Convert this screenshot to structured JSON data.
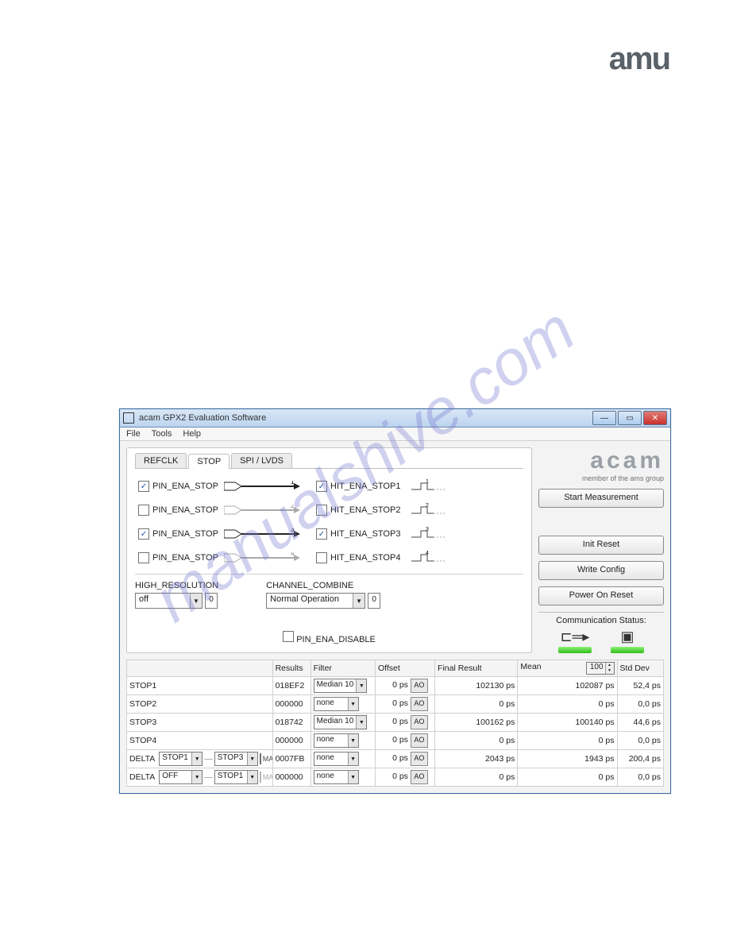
{
  "logo_corner": "amu",
  "watermark": "manualshive.com",
  "window": {
    "title": "acam GPX2 Evaluation Software",
    "menus": [
      "File",
      "Tools",
      "Help"
    ],
    "tabs": [
      "REFCLK",
      "STOP",
      "SPI / LVDS"
    ],
    "active_tab": 1
  },
  "pins": [
    {
      "label": "PIN_ENA_STOP",
      "checked": true,
      "arrow_on": true,
      "num": "1"
    },
    {
      "label": "PIN_ENA_STOP",
      "checked": false,
      "arrow_on": false,
      "num": "2"
    },
    {
      "label": "PIN_ENA_STOP",
      "checked": true,
      "arrow_on": true,
      "num": "3"
    },
    {
      "label": "PIN_ENA_STOP",
      "checked": false,
      "arrow_on": false,
      "num": "4"
    }
  ],
  "hits": [
    {
      "label": "HIT_ENA_STOP1",
      "checked": true,
      "num": "1"
    },
    {
      "label": "HIT_ENA_STOP2",
      "checked": false,
      "num": "2"
    },
    {
      "label": "HIT_ENA_STOP3",
      "checked": true,
      "num": "3"
    },
    {
      "label": "HIT_ENA_STOP4",
      "checked": false,
      "num": "4"
    }
  ],
  "cfg": {
    "high_res_label": "HIGH_RESOLUTION",
    "high_res_value": "off",
    "high_res_num": "0",
    "chan_combine_label": "CHANNEL_COMBINE",
    "chan_combine_value": "Normal Operation",
    "chan_combine_num": "0",
    "pin_ena_disable": "PIN_ENA_DISABLE"
  },
  "sidebar": {
    "acam_big": "acam",
    "acam_sub": "member of the ams group",
    "start": "Start Measurement",
    "init": "Init Reset",
    "write": "Write Config",
    "por": "Power On Reset",
    "comm_label": "Communication Status:"
  },
  "table": {
    "headers": [
      "",
      "Results",
      "Filter",
      "Offset",
      "Final Result",
      "Mean",
      "Std Dev"
    ],
    "mean_spin": "100",
    "rows": [
      {
        "label": "STOP1",
        "results": "018EF2",
        "filter": "Median 10",
        "offset": "0 ps",
        "final": "102130 ps",
        "mean": "102087 ps",
        "stddev": "52,4 ps"
      },
      {
        "label": "STOP2",
        "results": "000000",
        "filter": "none",
        "offset": "0 ps",
        "final": "0 ps",
        "mean": "0 ps",
        "stddev": "0,0 ps"
      },
      {
        "label": "STOP3",
        "results": "018742",
        "filter": "Median 10",
        "offset": "0 ps",
        "final": "100162 ps",
        "mean": "100140 ps",
        "stddev": "44,6 ps"
      },
      {
        "label": "STOP4",
        "results": "000000",
        "filter": "none",
        "offset": "0 ps",
        "final": "0 ps",
        "mean": "0 ps",
        "stddev": "0,0 ps"
      }
    ],
    "deltas": [
      {
        "a": "STOP1",
        "b": "STOP3",
        "math": false,
        "results": "0007FB",
        "filter": "none",
        "offset": "0 ps",
        "final": "2043 ps",
        "mean": "1943 ps",
        "stddev": "200,4 ps"
      },
      {
        "a": "OFF",
        "b": "STOP1",
        "math": false,
        "results": "000000",
        "filter": "none",
        "offset": "0 ps",
        "final": "0 ps",
        "mean": "0 ps",
        "stddev": "0,0 ps"
      }
    ],
    "delta_label": "DELTA",
    "math_label": "MATH",
    "ao": "AO"
  }
}
